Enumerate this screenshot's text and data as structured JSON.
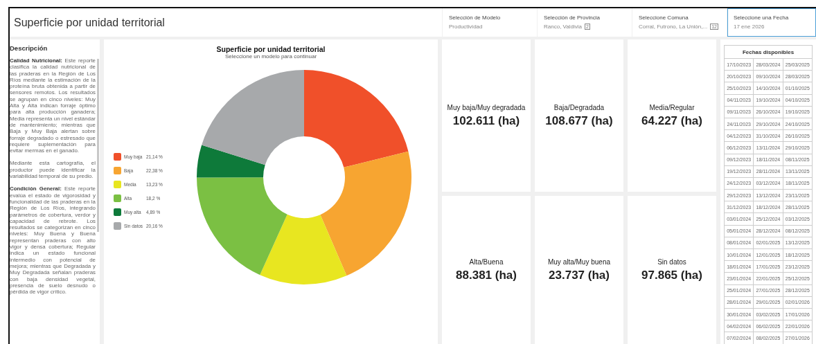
{
  "header": {
    "title": "Superficie por unidad territorial"
  },
  "filters": [
    {
      "label": "Selección de Modelo",
      "value": "Productividad",
      "selected": false
    },
    {
      "label": "Selección de Provincia",
      "value": "Ranco, Valdivia",
      "count": "2",
      "selected": false
    },
    {
      "label": "Seleccione Comuna",
      "value": "Corral, Futrono, La Unión,...",
      "count": "12",
      "selected": false
    },
    {
      "label": "Seleccione una Fecha",
      "value": "17 ene 2026",
      "selected": true
    }
  ],
  "description": {
    "title": "Descripción",
    "paragraphs": [
      "**Calidad Nutricional:** Este reporte clasifica la calidad nutricional de las praderas en la Región de Los Ríos mediante la estimación de la proteína bruta obtenida a partir de sensores remotos. Los resultados se agrupan en cinco niveles: Muy Alta y Alta indican forraje óptimo para alta producción ganadera; Media representa un nivel estándar de mantenimiento; mientras que Baja y Muy Baja alertan sobre forraje degradado o estresado que requiere suplementación para evitar mermas en el ganado.",
      "Mediante esta cartografía, el productor puede identificar la variabilidad temporal de su predio.",
      "**Condición General:** Este reporte evalúa el estado de vigorosidad y funcionalidad de las praderas en la Región de Los Ríos, integrando parámetros de cobertura, verdor y capacidad de rebrote. Los resultados se categorizan en cinco niveles: Muy Buena y Buena representan praderas con alto vigor y densa cobertura; Regular indica un estado funcional intermedio con potencial de mejora; mientras que Degradada y Muy Degradada señalan praderas con baja densidad vegetal, presencia de suelo desnudo o pérdida de vigor crítico."
    ]
  },
  "chart": {
    "title": "Superficie por unidad territorial",
    "subtitle": "Seleccione un modelo para continuar",
    "chart_data": {
      "type": "donut",
      "categories": [
        "Muy baja",
        "Baja",
        "Media",
        "Alta",
        "Muy alta",
        "Sin datos"
      ],
      "colors": [
        "#f0502a",
        "#f7a531",
        "#e8e620",
        "#7bc043",
        "#0e7a3a",
        "#a7a9ab"
      ],
      "series": [
        {
          "values": [
            21.14,
            22.38,
            13.23,
            18.2,
            4.89,
            20.16
          ]
        }
      ],
      "value_labels": [
        "21,14 %",
        "22,38 %",
        "13,23 %",
        "18,2 %",
        "4,89 %",
        "20,16 %"
      ]
    }
  },
  "cards": [
    {
      "label": "Muy baja/Muy degradada",
      "value": "102.611 (ha)"
    },
    {
      "label": "Baja/Degradada",
      "value": "108.677 (ha)"
    },
    {
      "label": "Media/Regular",
      "value": "64.227 (ha)"
    },
    {
      "label": "Alta/Buena",
      "value": "88.381 (ha)"
    },
    {
      "label": "Muy alta/Muy buena",
      "value": "23.737 (ha)"
    },
    {
      "label": "Sin datos",
      "value": "97.865 (ha)"
    }
  ],
  "dates": {
    "title": "Fechas disponibles",
    "rows": [
      [
        "17/10/2023",
        "28/03/2024",
        "25/03/2025"
      ],
      [
        "20/10/2023",
        "09/10/2024",
        "28/03/2025"
      ],
      [
        "25/10/2023",
        "14/10/2024",
        "01/10/2025"
      ],
      [
        "04/11/2023",
        "19/10/2024",
        "04/10/2025"
      ],
      [
        "09/11/2023",
        "26/10/2024",
        "19/10/2025"
      ],
      [
        "24/11/2023",
        "29/10/2024",
        "24/10/2025"
      ],
      [
        "04/12/2023",
        "31/10/2024",
        "26/10/2025"
      ],
      [
        "06/12/2023",
        "13/11/2024",
        "29/10/2025"
      ],
      [
        "09/12/2023",
        "18/11/2024",
        "08/11/2025"
      ],
      [
        "19/12/2023",
        "28/11/2024",
        "13/11/2025"
      ],
      [
        "24/12/2023",
        "03/12/2024",
        "18/11/2025"
      ],
      [
        "29/12/2023",
        "13/12/2024",
        "23/11/2025"
      ],
      [
        "31/12/2023",
        "18/12/2024",
        "28/11/2025"
      ],
      [
        "03/01/2024",
        "25/12/2024",
        "03/12/2025"
      ],
      [
        "05/01/2024",
        "28/12/2024",
        "08/12/2025"
      ],
      [
        "08/01/2024",
        "02/01/2025",
        "13/12/2025"
      ],
      [
        "10/01/2024",
        "12/01/2025",
        "18/12/2025"
      ],
      [
        "18/01/2024",
        "17/01/2025",
        "23/12/2025"
      ],
      [
        "23/01/2024",
        "22/01/2025",
        "25/12/2025"
      ],
      [
        "25/01/2024",
        "27/01/2025",
        "28/12/2025"
      ],
      [
        "28/01/2024",
        "29/01/2025",
        "02/01/2026"
      ],
      [
        "30/01/2024",
        "03/02/2025",
        "17/01/2026"
      ],
      [
        "04/02/2024",
        "06/02/2025",
        "22/01/2026"
      ],
      [
        "07/02/2024",
        "08/02/2025",
        "27/01/2026"
      ]
    ]
  }
}
